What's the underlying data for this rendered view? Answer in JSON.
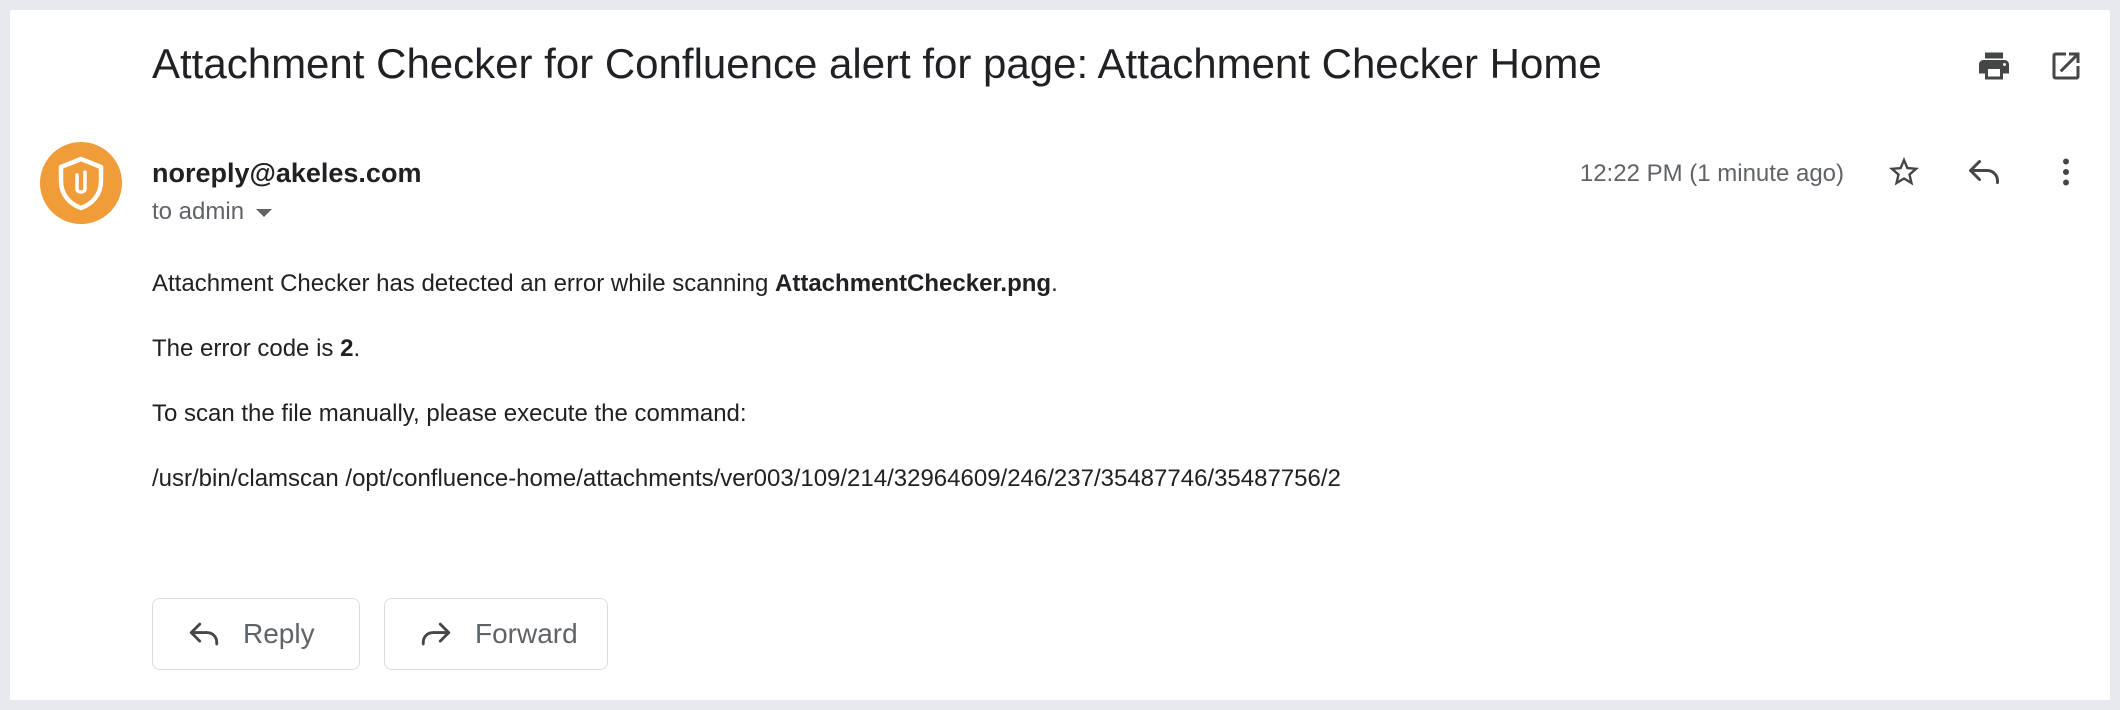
{
  "email": {
    "subject": "Attachment Checker for Confluence alert for page: Attachment Checker Home",
    "sender": "noreply@akeles.com",
    "recipient": "to admin",
    "timestamp": "12:22 PM (1 minute ago)",
    "avatar_color": "#f09c38"
  },
  "icons": {
    "print": "print-icon",
    "open_new_window": "open-in-new-icon",
    "star": "star-icon",
    "reply": "reply-icon",
    "more": "more-vert-icon",
    "avatar": "shield-paperclip-icon"
  },
  "body": {
    "line1_prefix": "Attachment Checker has detected an error while scanning ",
    "line1_filename": "AttachmentChecker.png",
    "line1_suffix": ".",
    "line2_prefix": "The error code is ",
    "line2_code": "2",
    "line2_suffix": ".",
    "line3": "To scan the file manually, please execute the command:",
    "line4": "/usr/bin/clamscan /opt/confluence-home/attachments/ver003/109/214/32964609/246/237/35487746/35487756/2"
  },
  "actions": {
    "reply_label": "Reply",
    "forward_label": "Forward"
  }
}
